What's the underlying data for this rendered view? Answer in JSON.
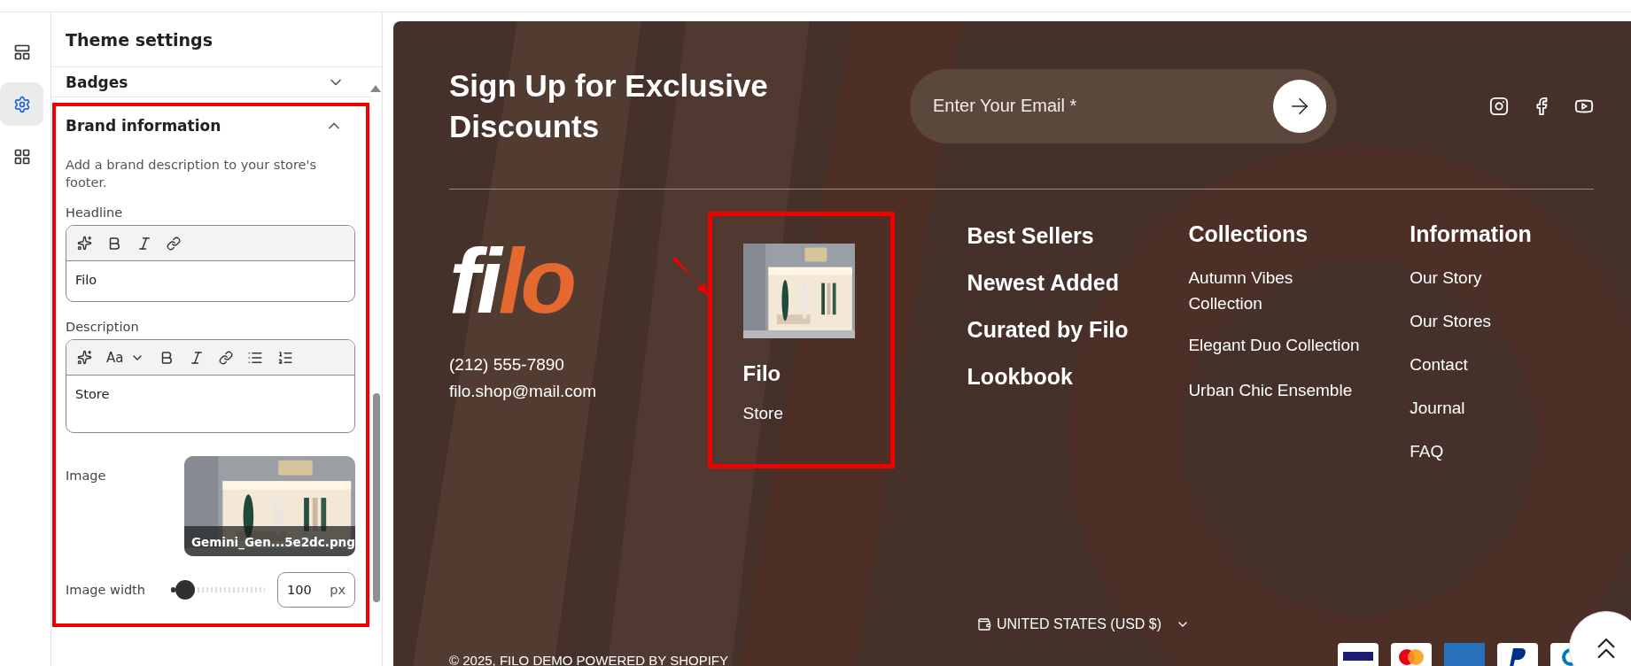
{
  "rail": [
    {
      "kind": "sections",
      "selected": false
    },
    {
      "kind": "settings",
      "selected": true
    },
    {
      "kind": "apps",
      "selected": false
    }
  ],
  "panel": {
    "title": "Theme settings",
    "collapsed_section": {
      "title": "Badges",
      "expanded": false
    },
    "section": {
      "title": "Brand information",
      "expanded": true,
      "help": "Add a brand description to your store's footer.",
      "headline": {
        "label": "Headline",
        "value": "Filo"
      },
      "description": {
        "label": "Description",
        "value": "Store",
        "toolbar_text": "Aa"
      },
      "image": {
        "label": "Image",
        "filename": "Gemini_Gen...5e2dc.png",
        "kind": "picture"
      },
      "image_width": {
        "label": "Image width",
        "level": 0.05,
        "value": "100",
        "unit": "px"
      }
    }
  },
  "footer": {
    "signup_title": "Sign Up for Exclusive Discounts",
    "email": {
      "placeholder": "Enter Your Email *"
    },
    "logo": [
      {
        "text": "fi",
        "color": "#ffffff"
      },
      {
        "text": "lo",
        "color": "#e5682f"
      }
    ],
    "phone": "(212) 555-7890",
    "mail": "filo.shop@mail.com",
    "brand": {
      "headline": "Filo",
      "description": "Store"
    },
    "menu_main": [
      "Best Sellers",
      "Newest Added",
      "Curated by Filo",
      "Lookbook"
    ],
    "columns": [
      {
        "title": "Collections",
        "links": [
          "Autumn Vibes Collection",
          "Elegant Duo Collection",
          "Urban Chic Ensemble"
        ]
      },
      {
        "title": "Information",
        "links": [
          "Our Story",
          "Our Stores",
          "Contact",
          "Journal",
          "FAQ"
        ]
      }
    ],
    "copyright": "© 2025, FILO DEMO POWERED BY SHOPIFY",
    "country": "UNITED STATES (USD $)"
  }
}
